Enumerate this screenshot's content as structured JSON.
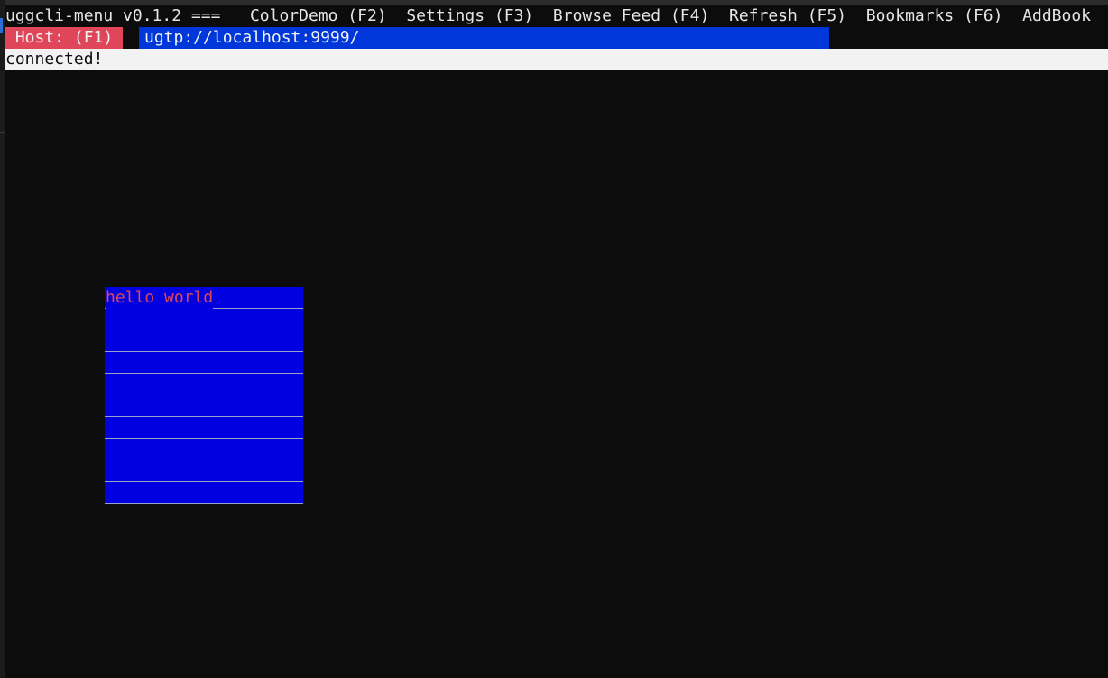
{
  "menu": {
    "app_title": "uggcli-menu v0.1.2 ===",
    "items": [
      {
        "label": "ColorDemo (F2)"
      },
      {
        "label": "Settings (F3)"
      },
      {
        "label": "Browse Feed (F4)"
      },
      {
        "label": "Refresh (F5)"
      },
      {
        "label": "Bookmarks (F6)"
      },
      {
        "label": "AddBook"
      }
    ]
  },
  "host": {
    "label": " Host: (F1) ",
    "value": "ugtp://localhost:9999/"
  },
  "status": {
    "text": "connected!"
  },
  "textbox": {
    "text": "hello world",
    "line_count": 10
  },
  "colors": {
    "background": "#0c0c0c",
    "host_label_bg": "#e0465a",
    "host_input_bg": "#0037da",
    "status_bg": "#f2f2f2",
    "textbox_bg": "#0000e0",
    "textbox_text": "#e0465a"
  }
}
